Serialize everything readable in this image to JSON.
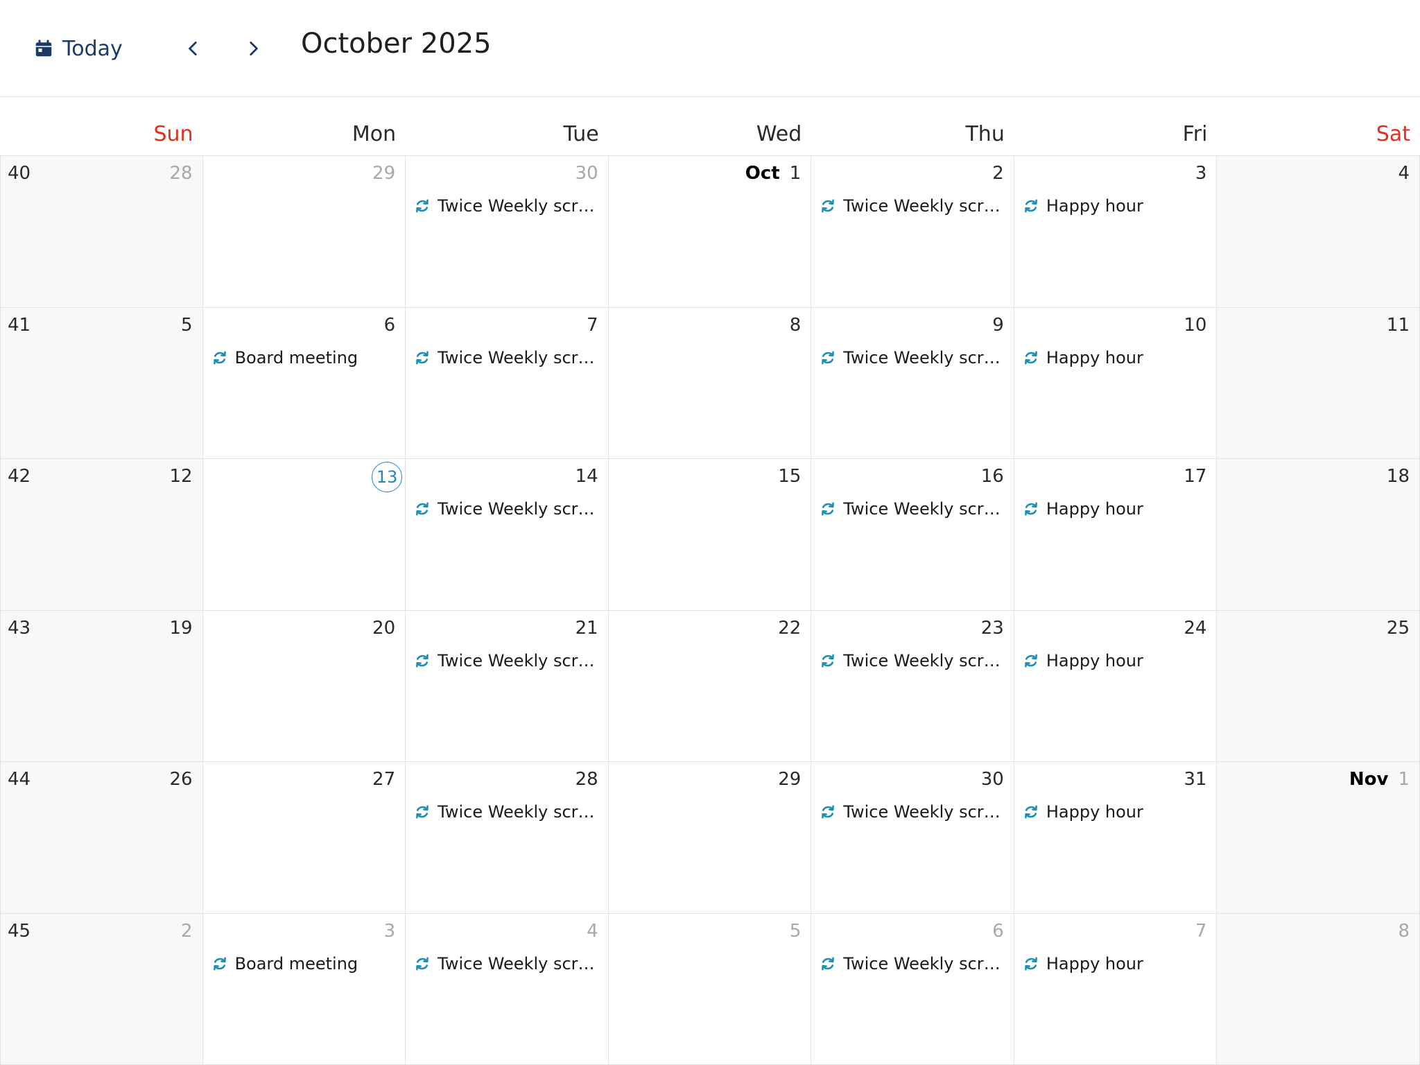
{
  "toolbar": {
    "today_label": "Today",
    "month_title": "October 2025",
    "icons": {
      "today": "calendar-icon",
      "prev": "chevron-left-icon",
      "next": "chevron-right-icon"
    },
    "accent_color": "#1b3a66"
  },
  "days_of_week": [
    "Sun",
    "Mon",
    "Tue",
    "Wed",
    "Thu",
    "Fri",
    "Sat"
  ],
  "colors": {
    "weekend_header": "#e0301e",
    "today_ring": "#1f86c8",
    "event_icon": "#1d8fb3"
  },
  "weeks": [
    {
      "week_number": "40",
      "days": [
        {
          "label": "28",
          "other_month": true,
          "events": []
        },
        {
          "label": "29",
          "other_month": true,
          "events": []
        },
        {
          "label": "30",
          "other_month": true,
          "events": [
            {
              "title": "Twice Weekly scrum",
              "icon": "recurring-icon"
            }
          ]
        },
        {
          "month": "Oct",
          "label": "1",
          "events": []
        },
        {
          "label": "2",
          "events": [
            {
              "title": "Twice Weekly scrum",
              "icon": "recurring-icon"
            }
          ]
        },
        {
          "label": "3",
          "events": [
            {
              "title": "Happy hour",
              "icon": "recurring-icon"
            }
          ]
        },
        {
          "label": "4",
          "events": []
        }
      ]
    },
    {
      "week_number": "41",
      "days": [
        {
          "label": "5",
          "events": []
        },
        {
          "label": "6",
          "events": [
            {
              "title": "Board meeting",
              "icon": "recurring-icon"
            }
          ]
        },
        {
          "label": "7",
          "events": [
            {
              "title": "Twice Weekly scrum",
              "icon": "recurring-icon"
            }
          ]
        },
        {
          "label": "8",
          "events": []
        },
        {
          "label": "9",
          "events": [
            {
              "title": "Twice Weekly scrum",
              "icon": "recurring-icon"
            }
          ]
        },
        {
          "label": "10",
          "events": [
            {
              "title": "Happy hour",
              "icon": "recurring-icon"
            }
          ]
        },
        {
          "label": "11",
          "events": []
        }
      ]
    },
    {
      "week_number": "42",
      "days": [
        {
          "label": "12",
          "events": []
        },
        {
          "label": "13",
          "today": true,
          "events": []
        },
        {
          "label": "14",
          "events": [
            {
              "title": "Twice Weekly scrum",
              "icon": "recurring-icon"
            }
          ]
        },
        {
          "label": "15",
          "events": []
        },
        {
          "label": "16",
          "events": [
            {
              "title": "Twice Weekly scrum",
              "icon": "recurring-icon"
            }
          ]
        },
        {
          "label": "17",
          "events": [
            {
              "title": "Happy hour",
              "icon": "recurring-icon"
            }
          ]
        },
        {
          "label": "18",
          "events": []
        }
      ]
    },
    {
      "week_number": "43",
      "days": [
        {
          "label": "19",
          "events": []
        },
        {
          "label": "20",
          "events": []
        },
        {
          "label": "21",
          "events": [
            {
              "title": "Twice Weekly scrum",
              "icon": "recurring-icon"
            }
          ]
        },
        {
          "label": "22",
          "events": []
        },
        {
          "label": "23",
          "events": [
            {
              "title": "Twice Weekly scrum",
              "icon": "recurring-icon"
            }
          ]
        },
        {
          "label": "24",
          "events": [
            {
              "title": "Happy hour",
              "icon": "recurring-icon"
            }
          ]
        },
        {
          "label": "25",
          "events": []
        }
      ]
    },
    {
      "week_number": "44",
      "days": [
        {
          "label": "26",
          "events": []
        },
        {
          "label": "27",
          "events": []
        },
        {
          "label": "28",
          "events": [
            {
              "title": "Twice Weekly scrum",
              "icon": "recurring-icon"
            }
          ]
        },
        {
          "label": "29",
          "events": []
        },
        {
          "label": "30",
          "events": [
            {
              "title": "Twice Weekly scrum",
              "icon": "recurring-icon"
            }
          ]
        },
        {
          "label": "31",
          "events": [
            {
              "title": "Happy hour",
              "icon": "recurring-icon"
            }
          ]
        },
        {
          "month": "Nov",
          "label": "1",
          "other_month": true,
          "events": []
        }
      ]
    },
    {
      "week_number": "45",
      "days": [
        {
          "label": "2",
          "other_month": true,
          "events": []
        },
        {
          "label": "3",
          "other_month": true,
          "events": [
            {
              "title": "Board meeting",
              "icon": "recurring-icon"
            }
          ]
        },
        {
          "label": "4",
          "other_month": true,
          "events": [
            {
              "title": "Twice Weekly scrum",
              "icon": "recurring-icon"
            }
          ]
        },
        {
          "label": "5",
          "other_month": true,
          "events": []
        },
        {
          "label": "6",
          "other_month": true,
          "events": [
            {
              "title": "Twice Weekly scrum",
              "icon": "recurring-icon"
            }
          ]
        },
        {
          "label": "7",
          "other_month": true,
          "events": [
            {
              "title": "Happy hour",
              "icon": "recurring-icon"
            }
          ]
        },
        {
          "label": "8",
          "other_month": true,
          "events": []
        }
      ]
    }
  ]
}
